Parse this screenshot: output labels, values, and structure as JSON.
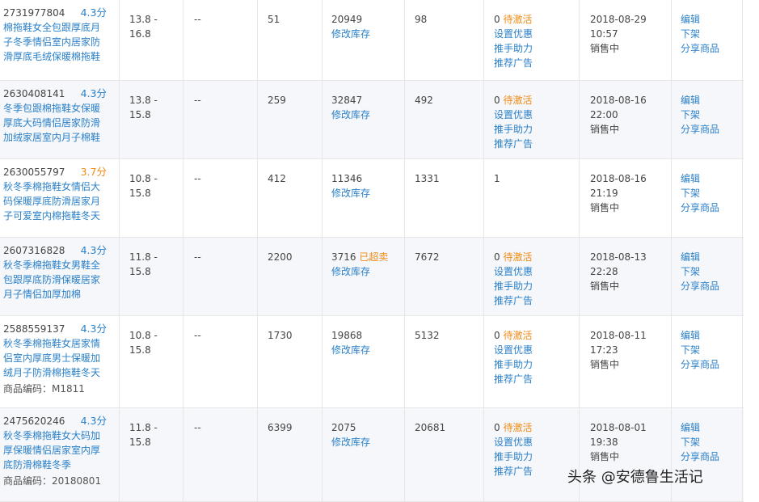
{
  "rows": [
    {
      "id": "2731977804",
      "score": "4.3分",
      "score_color": "blue",
      "name": "棉拖鞋女全包跟厚底月子冬季情侣室内居家防滑厚底毛绒保暖棉拖鞋",
      "name_lines": [
        "棉拖鞋女全包跟厚底月",
        "子冬季情侣室内居家防",
        "滑厚底毛绒保暖棉拖鞋"
      ],
      "code": "",
      "price": [
        "13.8 -",
        "16.8"
      ],
      "c3": "--",
      "c4": "51",
      "stock": "20949",
      "stock_tag": "",
      "stock_link": "修改库存",
      "sales": "98",
      "promo_num": "0",
      "promo_tag": "待激活",
      "promo_links": [
        "设置优惠",
        "推手助力",
        "推荐广告"
      ],
      "date": "2018-08-29",
      "time": "10:57",
      "status": "销售中",
      "actions": [
        "编辑",
        "下架",
        "分享商品"
      ]
    },
    {
      "id": "2630408141",
      "score": "4.3分",
      "score_color": "blue",
      "name": "冬季包跟棉拖鞋女保暖厚底大码情侣居家防滑加绒家居室内月子棉鞋",
      "name_lines": [
        "冬季包跟棉拖鞋女保暖",
        "厚底大码情侣居家防滑",
        "加绒家居室内月子棉鞋"
      ],
      "code": "",
      "price": [
        "13.8 -",
        "15.8"
      ],
      "c3": "--",
      "c4": "259",
      "stock": "32847",
      "stock_tag": "",
      "stock_link": "修改库存",
      "sales": "492",
      "promo_num": "0",
      "promo_tag": "待激活",
      "promo_links": [
        "设置优惠",
        "推手助力",
        "推荐广告"
      ],
      "date": "2018-08-16",
      "time": "22:00",
      "status": "销售中",
      "actions": [
        "编辑",
        "下架",
        "分享商品"
      ]
    },
    {
      "id": "2630055797",
      "score": "3.7分",
      "score_color": "orange",
      "name": "秋冬季棉拖鞋女情侣大码保暖厚底防滑居家月子可爱室内棉拖鞋冬天",
      "name_lines": [
        "秋冬季棉拖鞋女情侣大",
        "码保暖厚底防滑居家月",
        "子可爱室内棉拖鞋冬天"
      ],
      "code": "",
      "price": [
        "10.8 -",
        "15.8"
      ],
      "c3": "--",
      "c4": "412",
      "stock": "11346",
      "stock_tag": "",
      "stock_link": "修改库存",
      "sales": "1331",
      "promo_num": "1",
      "promo_tag": "",
      "promo_links": [],
      "date": "2018-08-16",
      "time": "21:19",
      "status": "销售中",
      "actions": [
        "编辑",
        "下架",
        "分享商品"
      ]
    },
    {
      "id": "2607316828",
      "score": "4.3分",
      "score_color": "blue",
      "name": "秋冬季棉拖鞋女男鞋全包跟厚底防滑保暖居家月子情侣加厚加棉",
      "name_lines": [
        "秋冬季棉拖鞋女男鞋全",
        "包跟厚底防滑保暖居家",
        "月子情侣加厚加棉"
      ],
      "code": "",
      "price": [
        "11.8 -",
        "15.8"
      ],
      "c3": "--",
      "c4": "2200",
      "stock": "3716",
      "stock_tag": "已超卖",
      "stock_link": "修改库存",
      "sales": "7672",
      "promo_num": "0",
      "promo_tag": "待激活",
      "promo_links": [
        "设置优惠",
        "推手助力",
        "推荐广告"
      ],
      "date": "2018-08-13",
      "time": "22:28",
      "status": "销售中",
      "actions": [
        "编辑",
        "下架",
        "分享商品"
      ]
    },
    {
      "id": "2588559137",
      "score": "4.3分",
      "score_color": "blue",
      "name": "秋冬季棉拖鞋女居家情侣室内厚底男士保暖加绒月子防滑棉拖鞋冬天",
      "name_lines": [
        "秋冬季棉拖鞋女居家情",
        "侣室内厚底男士保暖加",
        "绒月子防滑棉拖鞋冬天"
      ],
      "code": "商品编码：M1811",
      "price": [
        "10.8 -",
        "15.8"
      ],
      "c3": "--",
      "c4": "1730",
      "stock": "19868",
      "stock_tag": "",
      "stock_link": "修改库存",
      "sales": "5132",
      "promo_num": "0",
      "promo_tag": "待激活",
      "promo_links": [
        "设置优惠",
        "推手助力",
        "推荐广告"
      ],
      "date": "2018-08-11",
      "time": "17:23",
      "status": "销售中",
      "actions": [
        "编辑",
        "下架",
        "分享商品"
      ]
    },
    {
      "id": "2475620246",
      "score": "4.3分",
      "score_color": "blue",
      "name": "秋冬季棉拖鞋女大码加厚保暖情侣居家室内厚底防滑棉鞋冬季",
      "name_lines": [
        "秋冬季棉拖鞋女大码加",
        "厚保暖情侣居家室内厚",
        "底防滑棉鞋冬季"
      ],
      "code": "商品编码：20180801",
      "price": [
        "11.8 -",
        "15.8"
      ],
      "c3": "--",
      "c4": "6399",
      "stock": "2075",
      "stock_tag": "",
      "stock_link": "修改库存",
      "sales": "20681",
      "promo_num": "0",
      "promo_tag": "待激活",
      "promo_links": [
        "设置优惠",
        "推手助力",
        "推荐广告"
      ],
      "date": "2018-08-01",
      "time": "19:38",
      "status": "销售中",
      "actions": [
        "编辑",
        "下架",
        "分享商品"
      ]
    }
  ],
  "watermark": "头条 @安德鲁生活记",
  "colors": {
    "link": "#2b80c8",
    "warning": "#f08a14",
    "alt_row": "#f5f7fa",
    "border": "#e6e6e6"
  }
}
